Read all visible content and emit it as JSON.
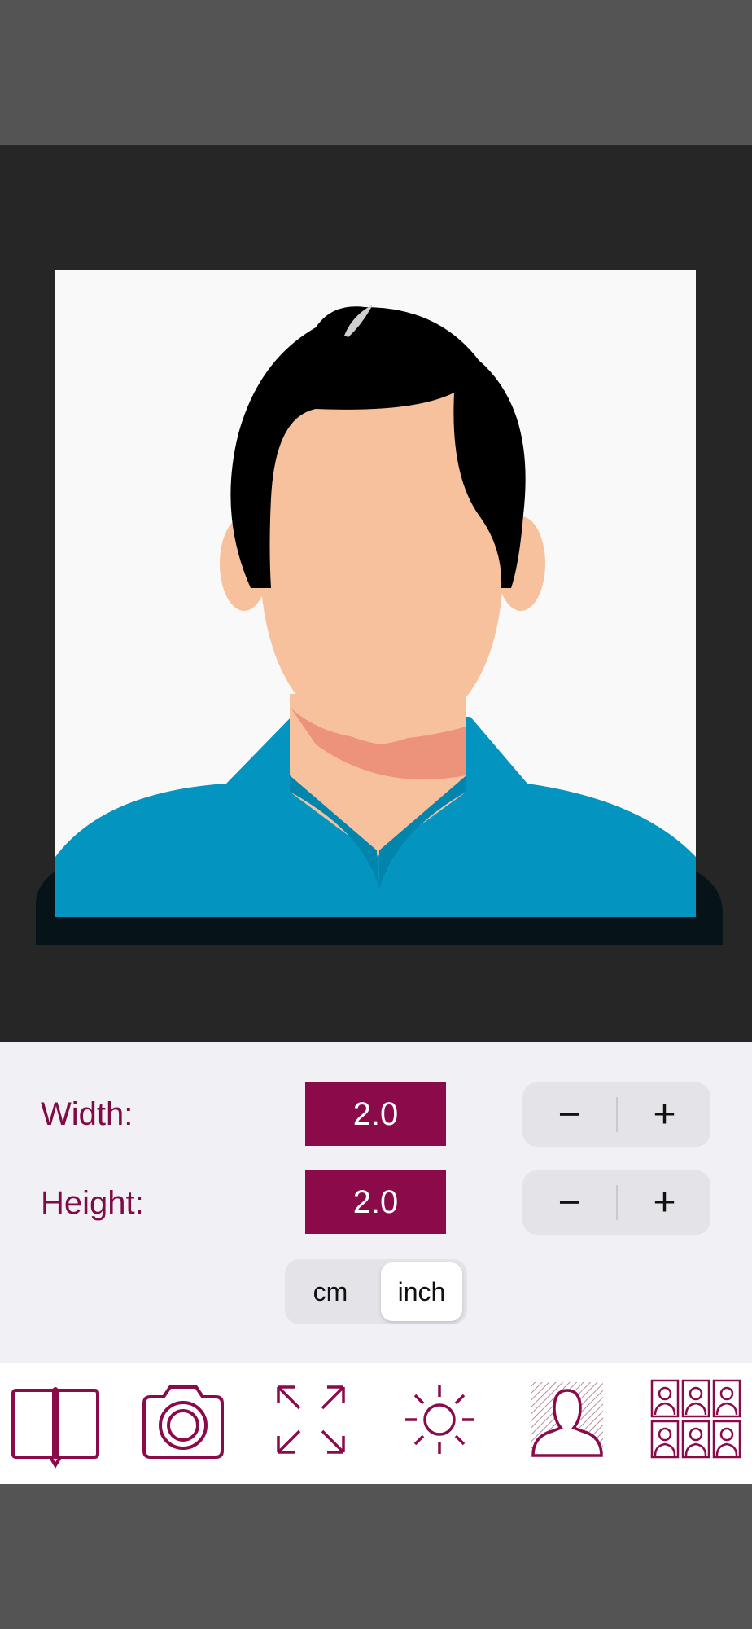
{
  "size": {
    "width_label": "Width:",
    "width_value": "2.0",
    "height_label": "Height:",
    "height_value": "2.0",
    "minus_label": "−",
    "plus_label": "+"
  },
  "units": {
    "options": [
      "cm",
      "inch"
    ],
    "selected": "inch"
  },
  "toolbar": {
    "icons": [
      "book-icon",
      "camera-icon",
      "resize-icon",
      "brightness-icon",
      "person-background-icon",
      "photo-grid-icon"
    ]
  },
  "colors": {
    "accent": "#8a0a4a",
    "shirt": "#0394bf",
    "skin": "#f7c19e",
    "hair": "#000000"
  }
}
